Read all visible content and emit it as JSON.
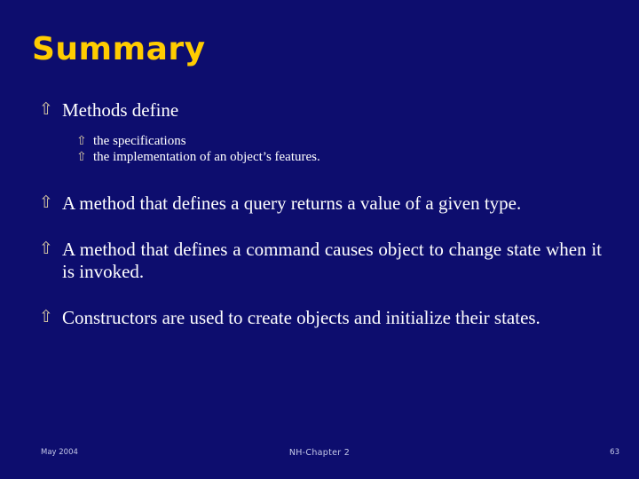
{
  "slide": {
    "background_color": "#0d0d6e",
    "title": "Summary",
    "title_color": "#ffcc00",
    "body_text_color": "#ffffff",
    "bullet_color": "#d9c9a3",
    "bullet_glyph": "⇧"
  },
  "content": {
    "blocks": [
      {
        "level": 1,
        "text": "Methods define"
      },
      {
        "level": 2,
        "text": "the specifications"
      },
      {
        "level": 2,
        "text": "the implementation of an object’s features."
      },
      {
        "level": 1,
        "text": "A method that defines a query returns a value of a given type."
      },
      {
        "level": 1,
        "text": "A method that defines a command causes object to change state when it is invoked."
      },
      {
        "level": 1,
        "text": "Constructors are used to create objects and initialize their states."
      }
    ]
  },
  "footer": {
    "date": "May 2004",
    "center": "NH-Chapter 2",
    "page_number": "63"
  }
}
